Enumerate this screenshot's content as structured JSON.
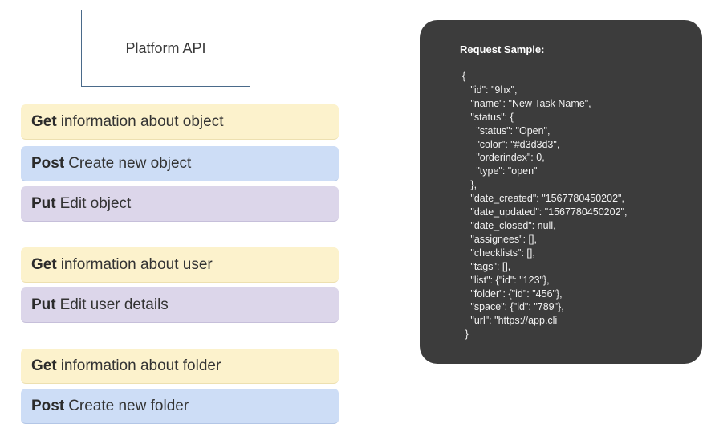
{
  "title": "Platform API",
  "endpoints": [
    {
      "method": "Get",
      "text": "information about object",
      "kind": "get"
    },
    {
      "method": "Post",
      "text": "Create new object",
      "kind": "post"
    },
    {
      "method": "Put",
      "text": "Edit object",
      "kind": "put"
    },
    {
      "method": "Get",
      "text": "information about user",
      "kind": "get"
    },
    {
      "method": "Put",
      "text": "Edit user details",
      "kind": "put"
    },
    {
      "method": "Get",
      "text": "information about folder",
      "kind": "get"
    },
    {
      "method": "Post",
      "text": "Create new folder",
      "kind": "post"
    }
  ],
  "request_sample": {
    "label": "Request Sample:",
    "code_lines": [
      "{",
      "   \"id\": \"9hx\",",
      "   \"name\": \"New Task Name\",",
      "   \"status\": {",
      "     \"status\": \"Open\",",
      "     \"color\": \"#d3d3d3\",",
      "     \"orderindex\": 0,",
      "     \"type\": \"open\"",
      "   },",
      "   \"date_created\": \"1567780450202\",",
      "   \"date_updated\": \"1567780450202\",",
      "   \"date_closed\": null,",
      "   \"assignees\": [],",
      "   \"checklists\": [],",
      "   \"tags\": [],",
      "   \"list\": {\"id\": \"123\"},",
      "   \"folder\": {\"id\": \"456\"},",
      "   \"space\": {\"id\": \"789\"},",
      "   \"url\": \"https://app.cli",
      " }"
    ]
  },
  "colors": {
    "get": "#fcf2cc",
    "post": "#cdddf6",
    "put": "#dcd6ea",
    "panel": "#3c3c3c"
  }
}
